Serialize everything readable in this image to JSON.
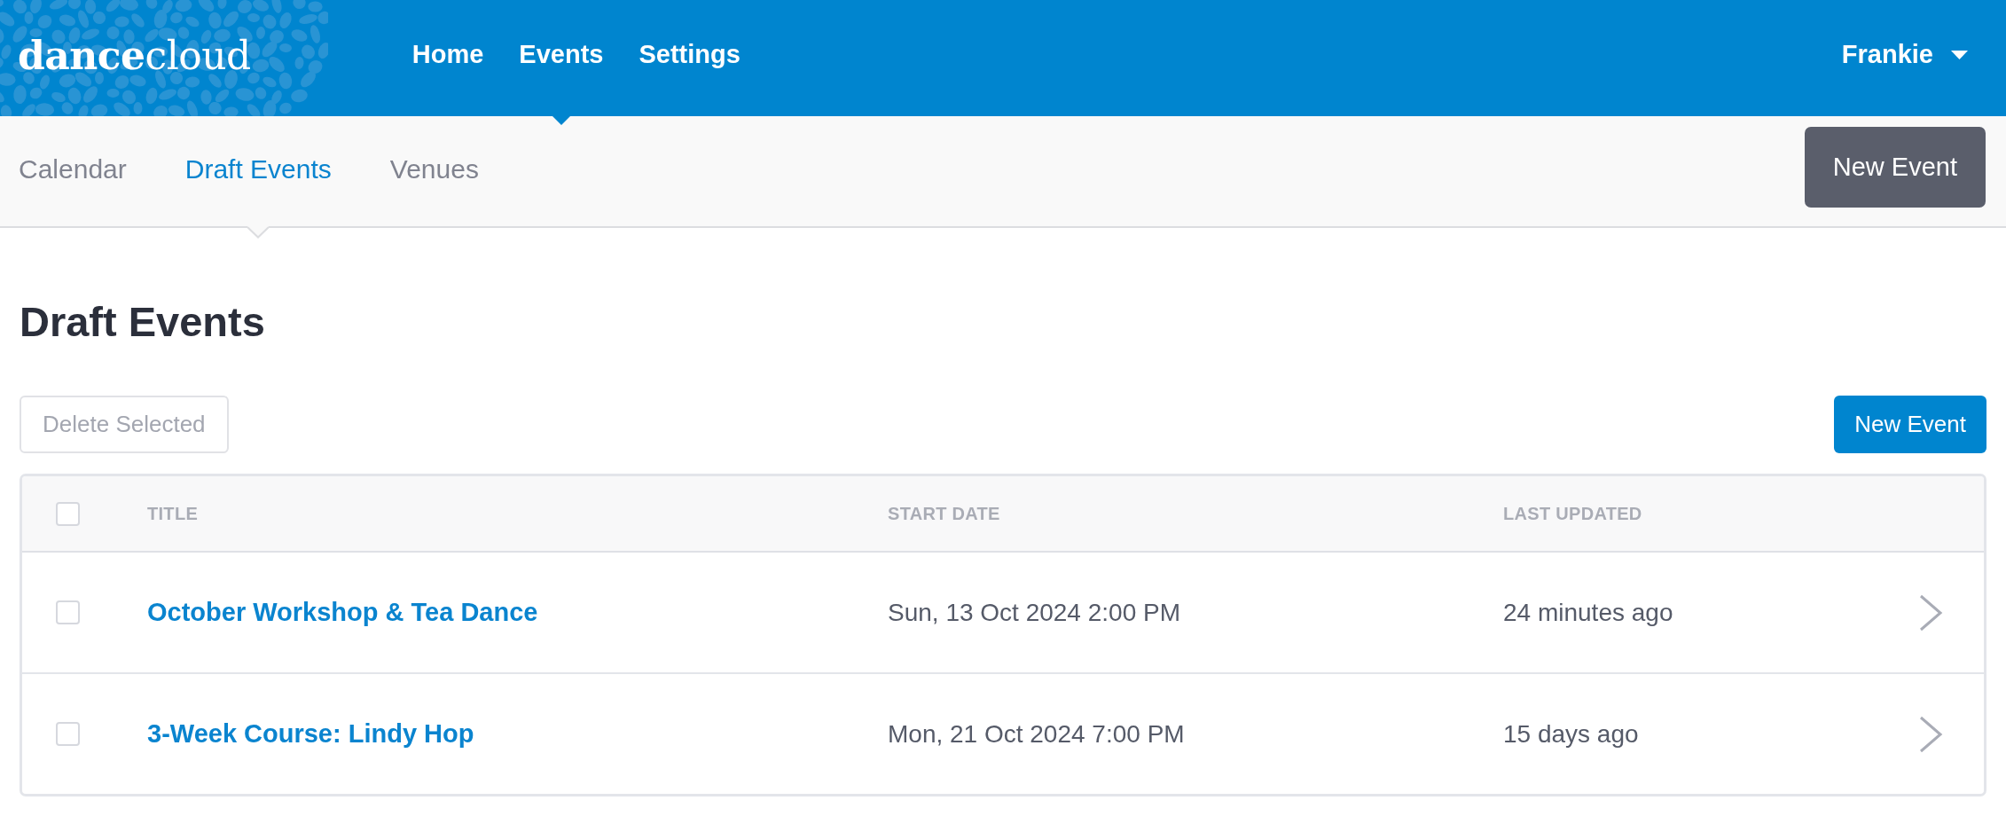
{
  "header": {
    "logo": "**dance**cloud",
    "nav": [
      {
        "label": "Home",
        "selected": false
      },
      {
        "label": "Events",
        "selected": true
      },
      {
        "label": "Settings",
        "selected": false
      }
    ],
    "user": {
      "name": "Frankie"
    }
  },
  "subnav": {
    "tabs": [
      {
        "label": "Calendar",
        "selected": false
      },
      {
        "label": "Draft Events",
        "selected": true
      },
      {
        "label": "Venues",
        "selected": false
      }
    ],
    "button": "New Event"
  },
  "page": {
    "title": "Draft Events",
    "delete_button": {
      "label": "Delete Selected",
      "disabled": true
    },
    "new_button": "New Event"
  },
  "table": {
    "select_all": {
      "checked": false
    },
    "columns": [
      "TITLE",
      "START DATE",
      "LAST UPDATED"
    ],
    "rows": [
      {
        "checked": false,
        "title": "October Workshop & Tea Dance",
        "start_date": "Sun, 13 Oct 2024 2:00 PM",
        "last_updated": "24 minutes ago"
      },
      {
        "checked": false,
        "title": "3-Week Course: Lindy Hop",
        "start_date": "Mon, 21 Oct 2024 7:00 PM",
        "last_updated": "15 days ago"
      }
    ]
  }
}
